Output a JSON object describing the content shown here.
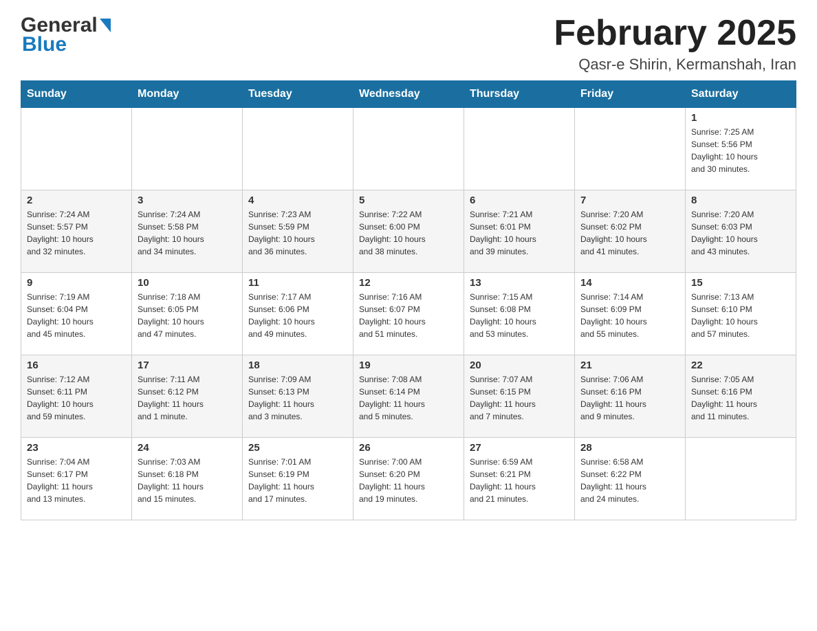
{
  "header": {
    "title": "February 2025",
    "subtitle": "Qasr-e Shirin, Kermanshah, Iran",
    "logo_general": "General",
    "logo_blue": "Blue"
  },
  "calendar": {
    "days_of_week": [
      "Sunday",
      "Monday",
      "Tuesday",
      "Wednesday",
      "Thursday",
      "Friday",
      "Saturday"
    ],
    "weeks": [
      [
        {
          "day": "",
          "info": ""
        },
        {
          "day": "",
          "info": ""
        },
        {
          "day": "",
          "info": ""
        },
        {
          "day": "",
          "info": ""
        },
        {
          "day": "",
          "info": ""
        },
        {
          "day": "",
          "info": ""
        },
        {
          "day": "1",
          "info": "Sunrise: 7:25 AM\nSunset: 5:56 PM\nDaylight: 10 hours\nand 30 minutes."
        }
      ],
      [
        {
          "day": "2",
          "info": "Sunrise: 7:24 AM\nSunset: 5:57 PM\nDaylight: 10 hours\nand 32 minutes."
        },
        {
          "day": "3",
          "info": "Sunrise: 7:24 AM\nSunset: 5:58 PM\nDaylight: 10 hours\nand 34 minutes."
        },
        {
          "day": "4",
          "info": "Sunrise: 7:23 AM\nSunset: 5:59 PM\nDaylight: 10 hours\nand 36 minutes."
        },
        {
          "day": "5",
          "info": "Sunrise: 7:22 AM\nSunset: 6:00 PM\nDaylight: 10 hours\nand 38 minutes."
        },
        {
          "day": "6",
          "info": "Sunrise: 7:21 AM\nSunset: 6:01 PM\nDaylight: 10 hours\nand 39 minutes."
        },
        {
          "day": "7",
          "info": "Sunrise: 7:20 AM\nSunset: 6:02 PM\nDaylight: 10 hours\nand 41 minutes."
        },
        {
          "day": "8",
          "info": "Sunrise: 7:20 AM\nSunset: 6:03 PM\nDaylight: 10 hours\nand 43 minutes."
        }
      ],
      [
        {
          "day": "9",
          "info": "Sunrise: 7:19 AM\nSunset: 6:04 PM\nDaylight: 10 hours\nand 45 minutes."
        },
        {
          "day": "10",
          "info": "Sunrise: 7:18 AM\nSunset: 6:05 PM\nDaylight: 10 hours\nand 47 minutes."
        },
        {
          "day": "11",
          "info": "Sunrise: 7:17 AM\nSunset: 6:06 PM\nDaylight: 10 hours\nand 49 minutes."
        },
        {
          "day": "12",
          "info": "Sunrise: 7:16 AM\nSunset: 6:07 PM\nDaylight: 10 hours\nand 51 minutes."
        },
        {
          "day": "13",
          "info": "Sunrise: 7:15 AM\nSunset: 6:08 PM\nDaylight: 10 hours\nand 53 minutes."
        },
        {
          "day": "14",
          "info": "Sunrise: 7:14 AM\nSunset: 6:09 PM\nDaylight: 10 hours\nand 55 minutes."
        },
        {
          "day": "15",
          "info": "Sunrise: 7:13 AM\nSunset: 6:10 PM\nDaylight: 10 hours\nand 57 minutes."
        }
      ],
      [
        {
          "day": "16",
          "info": "Sunrise: 7:12 AM\nSunset: 6:11 PM\nDaylight: 10 hours\nand 59 minutes."
        },
        {
          "day": "17",
          "info": "Sunrise: 7:11 AM\nSunset: 6:12 PM\nDaylight: 11 hours\nand 1 minute."
        },
        {
          "day": "18",
          "info": "Sunrise: 7:09 AM\nSunset: 6:13 PM\nDaylight: 11 hours\nand 3 minutes."
        },
        {
          "day": "19",
          "info": "Sunrise: 7:08 AM\nSunset: 6:14 PM\nDaylight: 11 hours\nand 5 minutes."
        },
        {
          "day": "20",
          "info": "Sunrise: 7:07 AM\nSunset: 6:15 PM\nDaylight: 11 hours\nand 7 minutes."
        },
        {
          "day": "21",
          "info": "Sunrise: 7:06 AM\nSunset: 6:16 PM\nDaylight: 11 hours\nand 9 minutes."
        },
        {
          "day": "22",
          "info": "Sunrise: 7:05 AM\nSunset: 6:16 PM\nDaylight: 11 hours\nand 11 minutes."
        }
      ],
      [
        {
          "day": "23",
          "info": "Sunrise: 7:04 AM\nSunset: 6:17 PM\nDaylight: 11 hours\nand 13 minutes."
        },
        {
          "day": "24",
          "info": "Sunrise: 7:03 AM\nSunset: 6:18 PM\nDaylight: 11 hours\nand 15 minutes."
        },
        {
          "day": "25",
          "info": "Sunrise: 7:01 AM\nSunset: 6:19 PM\nDaylight: 11 hours\nand 17 minutes."
        },
        {
          "day": "26",
          "info": "Sunrise: 7:00 AM\nSunset: 6:20 PM\nDaylight: 11 hours\nand 19 minutes."
        },
        {
          "day": "27",
          "info": "Sunrise: 6:59 AM\nSunset: 6:21 PM\nDaylight: 11 hours\nand 21 minutes."
        },
        {
          "day": "28",
          "info": "Sunrise: 6:58 AM\nSunset: 6:22 PM\nDaylight: 11 hours\nand 24 minutes."
        },
        {
          "day": "",
          "info": ""
        }
      ]
    ]
  }
}
